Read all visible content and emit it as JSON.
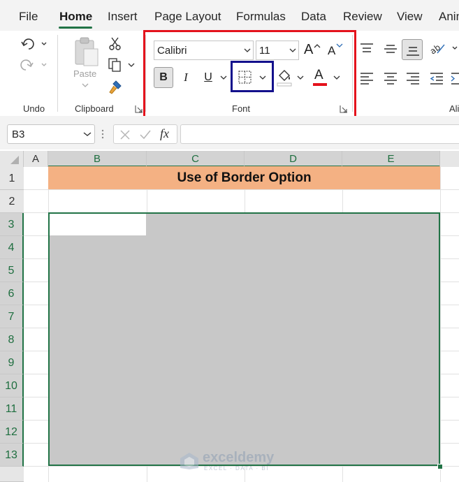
{
  "menu": {
    "tabs": [
      "File",
      "Home",
      "Insert",
      "Page Layout",
      "Formulas",
      "Data",
      "Review",
      "View",
      "Anim"
    ],
    "active": "Home"
  },
  "ribbon": {
    "groups": {
      "undo": "Undo",
      "clipboard": "Clipboard",
      "font": "Font",
      "alignment": "Ali"
    },
    "paste_label": "Paste",
    "font_name": "Calibri",
    "font_size": "11",
    "bold_label": "B",
    "italic_label": "I",
    "underline_label": "U",
    "font_color_label": "A",
    "grow_font_label": "A",
    "shrink_font_label": "A"
  },
  "formula_bar": {
    "name_box": "B3",
    "fx_label": "fx",
    "formula": ""
  },
  "sheet": {
    "columns": [
      "A",
      "B",
      "C",
      "D",
      "E"
    ],
    "rows": [
      "1",
      "2",
      "3",
      "4",
      "5",
      "6",
      "7",
      "8",
      "9",
      "10",
      "11",
      "12",
      "13"
    ],
    "title": "Use of Border Option",
    "active_cell": "B3",
    "selected_range": "B3:E13"
  },
  "watermark": {
    "name": "exceldemy",
    "tagline": "EXCEL · DATA · BI"
  },
  "colors": {
    "accent_green": "#217346",
    "title_fill": "#f4b183",
    "selection_fill": "#c8c8c8",
    "highlight_red": "#e4121c",
    "highlight_blue": "#13108c",
    "font_color_bar": "#e4121c"
  }
}
